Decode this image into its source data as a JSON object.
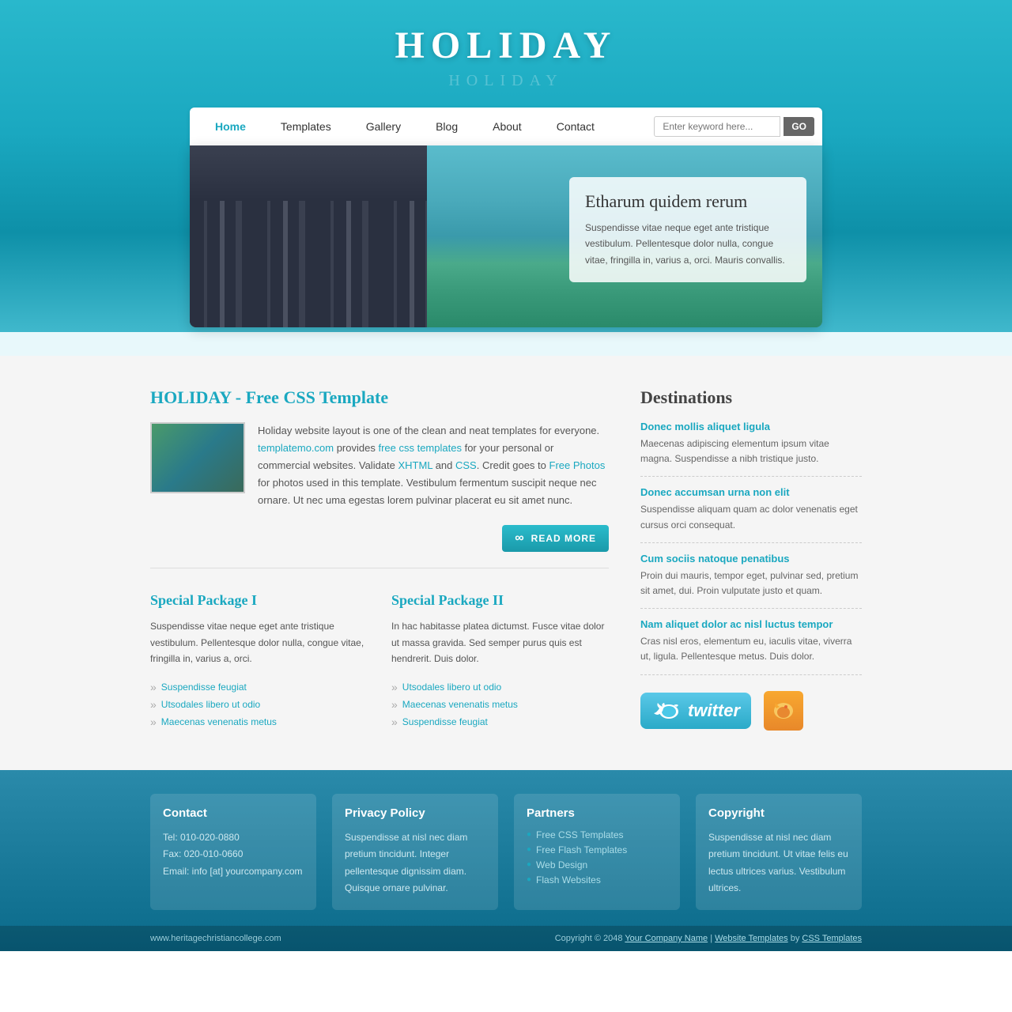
{
  "site": {
    "title": "HOLIDAY",
    "title_reflection": "HOLIDAY"
  },
  "nav": {
    "links": [
      {
        "label": "Home",
        "active": true
      },
      {
        "label": "Templates",
        "active": false
      },
      {
        "label": "Gallery",
        "active": false
      },
      {
        "label": "Blog",
        "active": false
      },
      {
        "label": "About",
        "active": false
      },
      {
        "label": "Contact",
        "active": false
      }
    ],
    "search_placeholder": "Enter keyword here...",
    "search_button": "GO"
  },
  "hero": {
    "heading": "Etharum quidem rerum",
    "body": "Suspendisse vitae neque eget ante tristique vestibulum. Pellentesque dolor nulla, congue vitae, fringilla in, varius a, orci. Mauris convallis."
  },
  "main": {
    "about": {
      "title": "HOLIDAY - Free CSS Template",
      "paragraph": "Holiday website layout is one of the clean and neat templates for everyone.",
      "links": {
        "templatemo": "templatemo.com",
        "free_css": "free css templates",
        "xhtml": "XHTML",
        "css": "CSS",
        "free_photos": "Free Photos"
      },
      "full_text": "Holiday website layout is one of the clean and neat templates for everyone. templatemo.com provides free css templates for your personal or commercial websites. Validate XHTML and CSS. Credit goes to Free Photos for photos used in this template. Vestibulum fermentum suscipit neque nec ornare. Ut nec uma egestas lorem pulvinar placerat eu sit amet nunc.",
      "read_more": "READ MORE"
    },
    "packages": [
      {
        "title": "Special Package I",
        "text": "Suspendisse vitae neque eget ante tristique vestibulum. Pellentesque dolor nulla, congue vitae, fringilla in, varius a, orci.",
        "items": [
          "Suspendisse feugiat",
          "Utsodales libero ut odio",
          "Maecenas venenatis metus"
        ]
      },
      {
        "title": "Special Package II",
        "text": "In hac habitasse platea dictumst. Fusce vitae dolor ut massa gravida. Sed semper purus quis est hendrerit. Duis dolor.",
        "items": [
          "Utsodales libero ut odio",
          "Maecenas venenatis metus",
          "Suspendisse feugiat"
        ]
      }
    ]
  },
  "destinations": {
    "title": "Destinations",
    "items": [
      {
        "title": "Donec mollis aliquet ligula",
        "text": "Maecenas adipiscing elementum ipsum vitae magna. Suspendisse a nibh tristique justo."
      },
      {
        "title": "Donec accumsan urna non elit",
        "text": "Suspendisse aliquam quam ac dolor venenatis eget cursus orci consequat."
      },
      {
        "title": "Cum sociis natoque penatibus",
        "text": "Proin dui mauris, tempor eget, pulvinar sed, pretium sit amet, dui. Proin vulputate justo et quam."
      },
      {
        "title": "Nam aliquet dolor ac nisl luctus tempor",
        "text": "Cras nisl eros, elementum eu, iaculis vitae, viverra ut, ligula. Pellentesque metus. Duis dolor."
      }
    ]
  },
  "footer": {
    "cols": [
      {
        "title": "Contact",
        "lines": [
          "Tel: 010-020-0880",
          "Fax: 020-010-0660",
          "Email: info [at] yourcompany.com"
        ]
      },
      {
        "title": "Privacy Policy",
        "text": "Suspendisse at nisl nec diam pretium tincidunt. Integer pellentesque dignissim diam. Quisque ornare pulvinar."
      },
      {
        "title": "Partners",
        "links": [
          "Free CSS Templates",
          "Free Flash Templates",
          "Web Design",
          "Flash Websites"
        ]
      },
      {
        "title": "Copyright",
        "text": "Suspendisse at nisl nec diam pretium tincidunt. Ut vitae felis eu lectus ultrices varius. Vestibulum ultrices."
      }
    ],
    "bottom": {
      "left": "www.heritagechristiancollege.com",
      "copyright": "Copyright © 2048",
      "company": "Your Company Name",
      "separator": "|",
      "website_templates": "Website Templates",
      "by": "by",
      "css_templates": "CSS Templates"
    }
  }
}
